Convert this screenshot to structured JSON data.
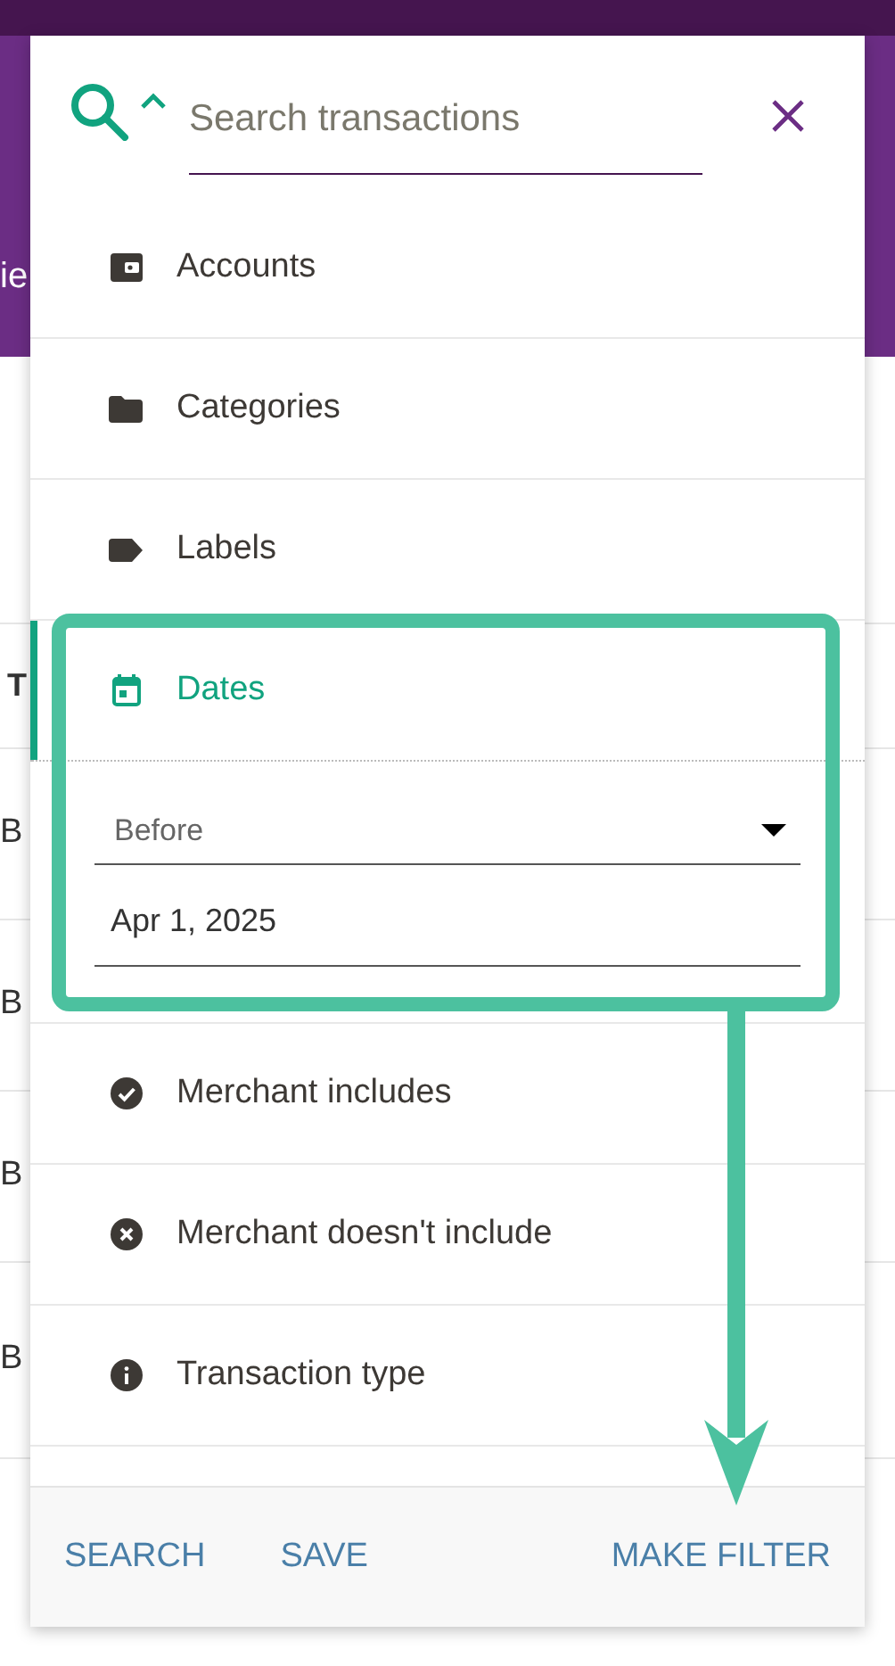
{
  "background": {
    "header_fragment": "ie",
    "column_fragment": "T",
    "row_fragments": [
      "B",
      "B",
      "B",
      "B"
    ]
  },
  "search": {
    "placeholder": "Search transactions"
  },
  "filters": [
    {
      "label": "Accounts",
      "kind": "wallet",
      "selected": false
    },
    {
      "label": "Categories",
      "kind": "folder",
      "selected": false
    },
    {
      "label": "Labels",
      "kind": "tag",
      "selected": false
    },
    {
      "label": "Dates",
      "kind": "calendar",
      "selected": true
    },
    {
      "label": "Merchant includes",
      "kind": "check",
      "selected": false
    },
    {
      "label": "Merchant doesn't include",
      "kind": "cross",
      "selected": false
    },
    {
      "label": "Transaction type",
      "kind": "info",
      "selected": false
    }
  ],
  "date_filter": {
    "mode": "Before",
    "value": "Apr 1, 2025"
  },
  "footer_buttons": [
    "SEARCH",
    "SAVE",
    "MAKE FILTER"
  ]
}
